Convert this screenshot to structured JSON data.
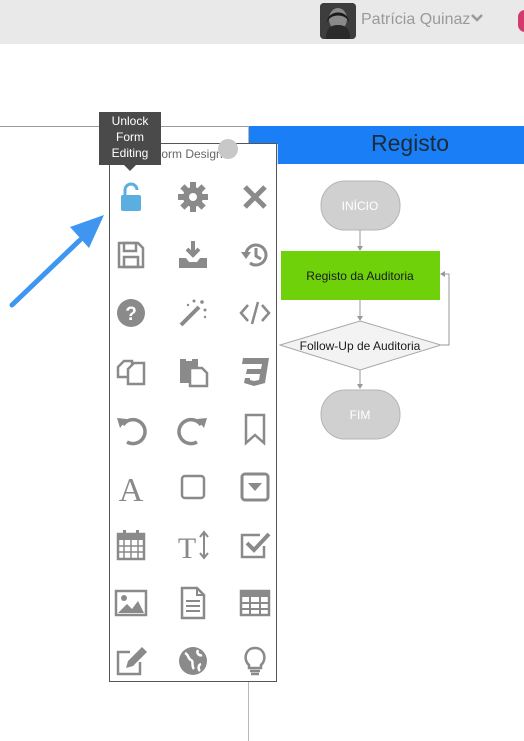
{
  "user": {
    "name": "Patrícia Quinaz"
  },
  "header": {
    "title": "Registo"
  },
  "panel": {
    "title": "Form Designer"
  },
  "tooltip": {
    "text": "Unlock\nForm\nEditing"
  },
  "flow": {
    "start": "INÍCIO",
    "task": "Registo da Auditoria",
    "decision": "Follow-Up de Auditoria",
    "end": "FIM"
  },
  "colors": {
    "accent": "#1a7ff7",
    "task": "#6fd10a",
    "lock": "#5aaee0",
    "icon": "#8a8a8a"
  },
  "tools": [
    {
      "icon": "lock-icon"
    },
    {
      "icon": "gear-icon"
    },
    {
      "icon": "close-icon"
    },
    {
      "icon": "save-icon"
    },
    {
      "icon": "download-icon"
    },
    {
      "icon": "history-icon"
    },
    {
      "icon": "help-icon"
    },
    {
      "icon": "magic-wand-icon"
    },
    {
      "icon": "code-icon"
    },
    {
      "icon": "copy-icon"
    },
    {
      "icon": "paste-icon"
    },
    {
      "icon": "css3-icon"
    },
    {
      "icon": "undo-icon"
    },
    {
      "icon": "redo-icon"
    },
    {
      "icon": "bookmark-icon"
    },
    {
      "icon": "text-icon"
    },
    {
      "icon": "square-icon"
    },
    {
      "icon": "dropdown-icon"
    },
    {
      "icon": "calendar-icon"
    },
    {
      "icon": "text-height-icon"
    },
    {
      "icon": "checkbox-icon"
    },
    {
      "icon": "image-icon"
    },
    {
      "icon": "document-icon"
    },
    {
      "icon": "table-icon"
    },
    {
      "icon": "edit-icon"
    },
    {
      "icon": "globe-icon"
    },
    {
      "icon": "lightbulb-icon"
    }
  ]
}
